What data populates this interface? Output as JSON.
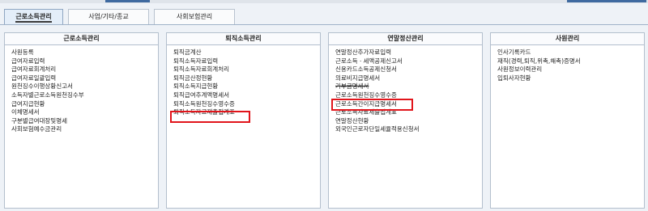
{
  "tabs": [
    {
      "label": "근로소득관리",
      "active": true
    },
    {
      "label": "사업/기타/종교",
      "active": false
    },
    {
      "label": "사회보험관리",
      "active": false
    }
  ],
  "panels": [
    {
      "title": "근로소득관리",
      "items": [
        "사원등록",
        "급여자료입력",
        "급여자료회계처리",
        "급여자료일괄입력",
        "원천징수이행상황신고서",
        "소득자별근로소득원천징수부",
        "급여지급현황",
        "이체명세서",
        "구분별급여대장및명세",
        "사회보험예수금관리"
      ]
    },
    {
      "title": "퇴직소득관리",
      "items": [
        "퇴직금계산",
        "퇴직소득자료입력",
        "퇴직소득자료회계처리",
        "퇴직금산정현황",
        "퇴직소득지급현황",
        "퇴직급여추계액명세서",
        "퇴직소득원천징수영수증",
        "퇴직소득자료제출집계표"
      ]
    },
    {
      "title": "연말정산관리",
      "items": [
        "연말정산추가자료입력",
        "근로소득ㆍ세액공제신고서",
        "신용카드소득공제신청서",
        "의료비지급명세서",
        "기부금명세서",
        "근로소득원천징수영수증",
        "근로소득간이지급명세서",
        "근로소득자료제출집계표",
        "연말정산현황",
        "외국인근로자단일세율적용신청서"
      ]
    },
    {
      "title": "사원관리",
      "items": [
        "인사기록카드",
        "재직(경력,퇴직,위촉,해촉)증명서",
        "사원정보이력관리",
        "입퇴사자현황"
      ]
    }
  ],
  "highlights": [
    "퇴직소득원천징수영수증",
    "근로소득원천징수영수증"
  ],
  "colors": {
    "highlight": "#e1151b",
    "active_tab": "#e4eef9",
    "panel_border": "#b3bfcd"
  }
}
